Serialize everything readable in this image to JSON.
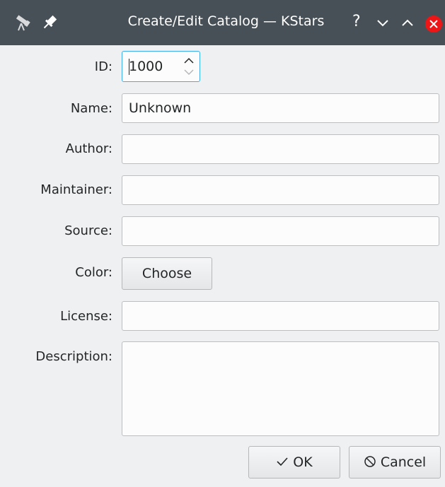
{
  "window": {
    "title": "Create/Edit Catalog — KStars",
    "help_symbol": "?",
    "minimize_symbol": "⌄",
    "maximize_symbol": "⌃"
  },
  "form": {
    "id": {
      "label": "ID:",
      "value": "1000"
    },
    "name": {
      "label": "Name:",
      "value": "Unknown"
    },
    "author": {
      "label": "Author:",
      "value": ""
    },
    "maintainer": {
      "label": "Maintainer:",
      "value": ""
    },
    "source": {
      "label": "Source:",
      "value": ""
    },
    "color": {
      "label": "Color:",
      "button_label": "Choose"
    },
    "license": {
      "label": "License:",
      "value": ""
    },
    "description": {
      "label": "Description:",
      "value": ""
    }
  },
  "buttons": {
    "ok_label": "OK",
    "ok_icon": "checkmark-icon",
    "cancel_label": "Cancel",
    "cancel_icon": "cancel-icon"
  },
  "colors": {
    "titlebar": "#475057",
    "focus_border": "#3daee9",
    "close_button": "#ed1515"
  }
}
